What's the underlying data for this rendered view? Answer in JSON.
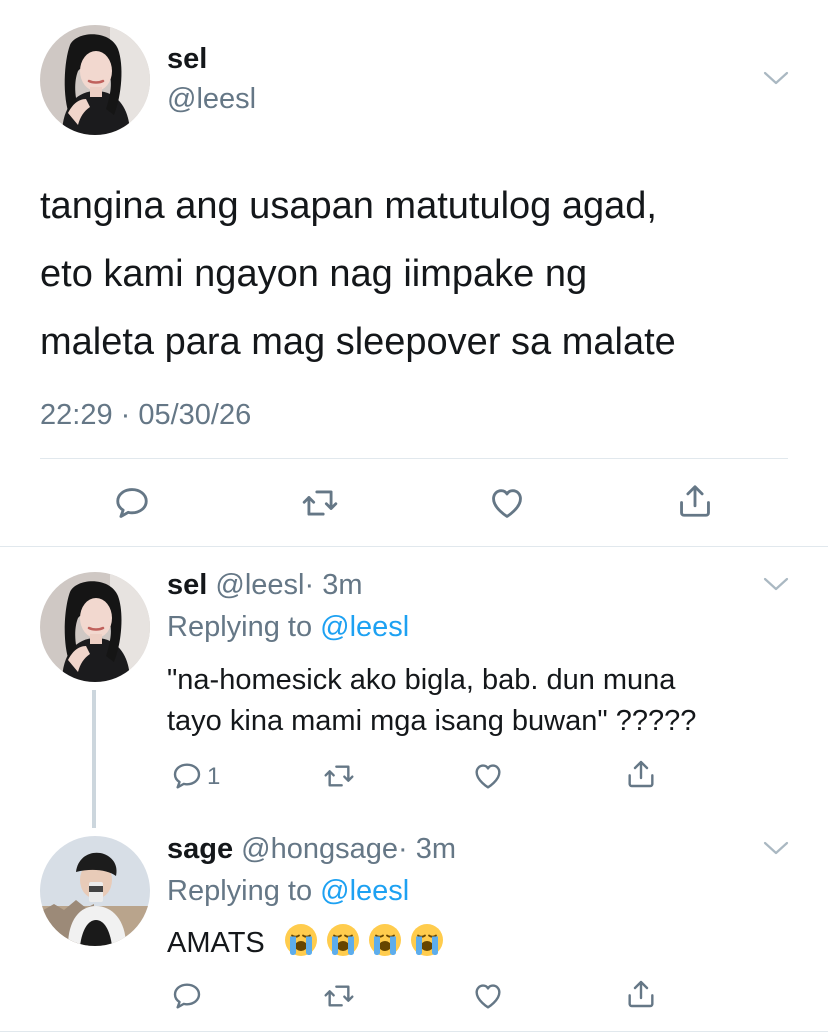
{
  "colors": {
    "link": "#1da1f2",
    "muted": "#657786",
    "text": "#14171a",
    "divider": "#e1e8ed"
  },
  "main_tweet": {
    "display_name": "sel",
    "handle": "@leesl",
    "text_lines": [
      "tangina ang usapan matutulog agad,",
      "eto kami ngayon nag iimpake ng",
      "maleta para mag sleepover sa malate"
    ],
    "timestamp": "22:29 · 05/30/26",
    "actions": [
      "reply-icon",
      "retweet-icon",
      "like-icon",
      "share-icon"
    ]
  },
  "replies": [
    {
      "display_name": "sel",
      "handle": "@leesl",
      "time": "· 3m",
      "replying_prefix": "Replying to",
      "replying_to": "@leesl",
      "text_lines": [
        "\"na-homesick ako bigla, bab. dun muna",
        "tayo kina mami mga isang buwan\" ?????"
      ],
      "reply_count": "1"
    },
    {
      "display_name": "sage",
      "handle": "@hongsage",
      "time": "· 3m",
      "replying_prefix": "Replying to",
      "replying_to": "@leesl",
      "text": "AMATS",
      "emoji": [
        "loudly-crying-face-icon",
        "loudly-crying-face-icon",
        "loudly-crying-face-icon",
        "loudly-crying-face-icon"
      ],
      "reply_count": ""
    }
  ]
}
